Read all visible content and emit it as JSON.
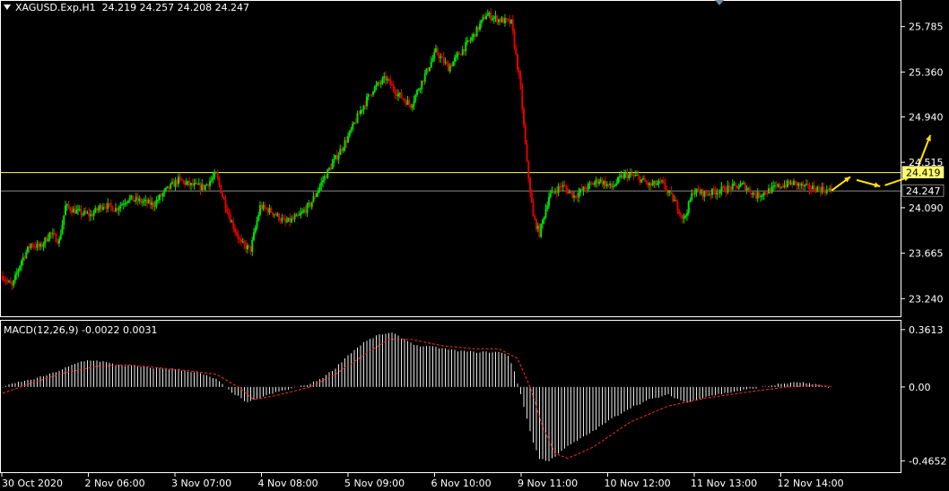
{
  "header": {
    "symbol": "XAGUSD.Exp,H1",
    "ohlc": "24.219 24.257 24.208 24.247"
  },
  "macd_label": "MACD(12,26,9) -0.0022 0.0031",
  "colors": {
    "background": "#000000",
    "bull": "#00e000",
    "bear": "#e00000",
    "level_line": "#ffff66",
    "price_line": "#8c8c8c",
    "histogram": "#ffffff",
    "signal": "#ff2a2a",
    "arrow": "#ffe400",
    "grid_border": "#ffffff"
  },
  "chart_data": [
    {
      "type": "candlestick",
      "ylim": [
        23.1,
        26.0
      ],
      "y_ticks": [
        "25.785",
        "25.360",
        "24.940",
        "24.515",
        "24.090",
        "23.665",
        "23.240"
      ],
      "x_ticks": [
        "30 Oct 2020",
        "2 Nov 06:00",
        "3 Nov 07:00",
        "4 Nov 08:00",
        "5 Nov 09:00",
        "6 Nov 10:00",
        "9 Nov 11:00",
        "10 Nov 12:00",
        "11 Nov 13:00",
        "12 Nov 14:00"
      ],
      "level_line": 24.419,
      "level_label": "24.419",
      "current_price": 24.247,
      "current_label": "24.247",
      "close_path": [
        [
          0,
          23.45
        ],
        [
          6,
          23.35
        ],
        [
          12,
          23.6
        ],
        [
          18,
          23.75
        ],
        [
          24,
          23.72
        ],
        [
          30,
          23.85
        ],
        [
          36,
          23.78
        ],
        [
          40,
          24.1
        ],
        [
          48,
          24.05
        ],
        [
          56,
          24.02
        ],
        [
          64,
          24.12
        ],
        [
          72,
          24.08
        ],
        [
          80,
          24.18
        ],
        [
          88,
          24.15
        ],
        [
          96,
          24.12
        ],
        [
          104,
          24.25
        ],
        [
          112,
          24.35
        ],
        [
          120,
          24.3
        ],
        [
          128,
          24.28
        ],
        [
          136,
          24.4
        ],
        [
          140,
          24.2
        ],
        [
          146,
          23.95
        ],
        [
          152,
          23.75
        ],
        [
          158,
          23.7
        ],
        [
          164,
          24.1
        ],
        [
          172,
          24.05
        ],
        [
          180,
          23.95
        ],
        [
          188,
          24.0
        ],
        [
          196,
          24.12
        ],
        [
          204,
          24.35
        ],
        [
          212,
          24.55
        ],
        [
          220,
          24.75
        ],
        [
          228,
          25.0
        ],
        [
          236,
          25.2
        ],
        [
          244,
          25.3
        ],
        [
          252,
          25.15
        ],
        [
          260,
          25.05
        ],
        [
          268,
          25.3
        ],
        [
          276,
          25.55
        ],
        [
          284,
          25.4
        ],
        [
          292,
          25.55
        ],
        [
          300,
          25.7
        ],
        [
          308,
          25.9
        ],
        [
          316,
          25.85
        ],
        [
          324,
          25.82
        ],
        [
          330,
          25.2
        ],
        [
          334,
          24.5
        ],
        [
          338,
          24.0
        ],
        [
          342,
          23.85
        ],
        [
          348,
          24.2
        ],
        [
          356,
          24.3
        ],
        [
          364,
          24.2
        ],
        [
          372,
          24.28
        ],
        [
          380,
          24.35
        ],
        [
          388,
          24.28
        ],
        [
          396,
          24.4
        ],
        [
          404,
          24.38
        ],
        [
          412,
          24.3
        ],
        [
          420,
          24.32
        ],
        [
          428,
          24.15
        ],
        [
          434,
          23.98
        ],
        [
          440,
          24.25
        ],
        [
          448,
          24.22
        ],
        [
          456,
          24.25
        ],
        [
          464,
          24.28
        ],
        [
          472,
          24.3
        ],
        [
          480,
          24.2
        ],
        [
          488,
          24.25
        ],
        [
          496,
          24.3
        ],
        [
          504,
          24.32
        ],
        [
          512,
          24.28
        ],
        [
          520,
          24.27
        ],
        [
          527,
          24.247
        ]
      ],
      "arrows": [
        [
          [
            528,
            24.25
          ],
          [
            540,
            24.38
          ]
        ],
        [
          [
            544,
            24.35
          ],
          [
            559,
            24.29
          ]
        ],
        [
          [
            562,
            24.3
          ],
          [
            578,
            24.38
          ]
        ],
        [
          [
            581,
            24.39
          ],
          [
            591,
            24.77
          ]
        ]
      ]
    },
    {
      "type": "bar+line",
      "title": "MACD(12,26,9)",
      "ylim": [
        -0.52,
        0.4
      ],
      "y_ticks": [
        "0.3613",
        "0.00",
        "-0.4652"
      ],
      "histogram_path": [
        [
          0,
          0.0
        ],
        [
          10,
          0.03
        ],
        [
          20,
          0.05
        ],
        [
          30,
          0.08
        ],
        [
          40,
          0.12
        ],
        [
          50,
          0.16
        ],
        [
          56,
          0.17
        ],
        [
          64,
          0.16
        ],
        [
          72,
          0.14
        ],
        [
          84,
          0.13
        ],
        [
          96,
          0.12
        ],
        [
          112,
          0.11
        ],
        [
          124,
          0.09
        ],
        [
          136,
          0.05
        ],
        [
          144,
          -0.02
        ],
        [
          150,
          -0.06
        ],
        [
          156,
          -0.1
        ],
        [
          166,
          -0.06
        ],
        [
          176,
          -0.03
        ],
        [
          188,
          0.0
        ],
        [
          196,
          0.02
        ],
        [
          204,
          0.06
        ],
        [
          212,
          0.12
        ],
        [
          220,
          0.2
        ],
        [
          230,
          0.28
        ],
        [
          240,
          0.33
        ],
        [
          248,
          0.34
        ],
        [
          256,
          0.3
        ],
        [
          264,
          0.26
        ],
        [
          276,
          0.25
        ],
        [
          288,
          0.23
        ],
        [
          300,
          0.22
        ],
        [
          316,
          0.22
        ],
        [
          322,
          0.2
        ],
        [
          326,
          0.1
        ],
        [
          330,
          -0.05
        ],
        [
          334,
          -0.2
        ],
        [
          338,
          -0.35
        ],
        [
          342,
          -0.45
        ],
        [
          348,
          -0.47
        ],
        [
          356,
          -0.4
        ],
        [
          364,
          -0.35
        ],
        [
          376,
          -0.28
        ],
        [
          388,
          -0.2
        ],
        [
          400,
          -0.13
        ],
        [
          412,
          -0.08
        ],
        [
          424,
          -0.05
        ],
        [
          436,
          -0.1
        ],
        [
          448,
          -0.06
        ],
        [
          460,
          -0.04
        ],
        [
          472,
          -0.02
        ],
        [
          484,
          0.0
        ],
        [
          496,
          0.02
        ],
        [
          508,
          0.03
        ],
        [
          520,
          0.01
        ],
        [
          527,
          -0.0022
        ]
      ],
      "signal_path": [
        [
          0,
          -0.04
        ],
        [
          20,
          0.03
        ],
        [
          40,
          0.09
        ],
        [
          60,
          0.13
        ],
        [
          80,
          0.14
        ],
        [
          100,
          0.12
        ],
        [
          120,
          0.1
        ],
        [
          136,
          0.08
        ],
        [
          150,
          0.0
        ],
        [
          160,
          -0.08
        ],
        [
          176,
          -0.05
        ],
        [
          196,
          0.0
        ],
        [
          212,
          0.08
        ],
        [
          230,
          0.2
        ],
        [
          246,
          0.3
        ],
        [
          260,
          0.3
        ],
        [
          280,
          0.26
        ],
        [
          300,
          0.24
        ],
        [
          316,
          0.24
        ],
        [
          328,
          0.18
        ],
        [
          336,
          0.0
        ],
        [
          344,
          -0.25
        ],
        [
          352,
          -0.42
        ],
        [
          360,
          -0.45
        ],
        [
          376,
          -0.38
        ],
        [
          400,
          -0.22
        ],
        [
          424,
          -0.12
        ],
        [
          448,
          -0.07
        ],
        [
          476,
          -0.03
        ],
        [
          500,
          0.0
        ],
        [
          520,
          0.01
        ],
        [
          527,
          0.0031
        ]
      ]
    }
  ]
}
